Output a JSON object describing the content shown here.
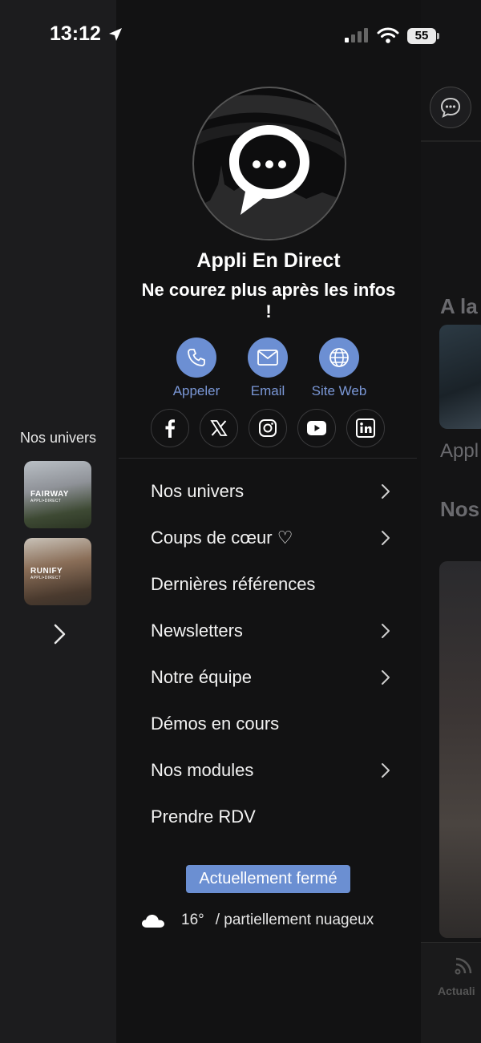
{
  "status_bar": {
    "time": "13:12",
    "battery": "55"
  },
  "left_rail": {
    "title": "Nos univers",
    "items": [
      {
        "brand": "FAIRWAY",
        "sub": "APPLI•DIRECT"
      },
      {
        "brand": "RUNIFY",
        "sub": "APPLI•DIRECT"
      }
    ]
  },
  "profile": {
    "name": "Appli En Direct",
    "tagline": "Ne courez plus après les infos !"
  },
  "actions": {
    "call": "Appeler",
    "email": "Email",
    "web": "Site Web"
  },
  "menu": {
    "items": [
      {
        "label": "Nos univers",
        "has_chevron": true
      },
      {
        "label": "Coups de cœur ♡",
        "has_chevron": true
      },
      {
        "label": "Dernières références",
        "has_chevron": false
      },
      {
        "label": "Newsletters",
        "has_chevron": true
      },
      {
        "label": "Notre équipe",
        "has_chevron": true
      },
      {
        "label": "Démos en cours",
        "has_chevron": false
      },
      {
        "label": "Nos modules",
        "has_chevron": true
      },
      {
        "label": "Prendre RDV",
        "has_chevron": false
      }
    ]
  },
  "status": {
    "label": "Actuellement fermé"
  },
  "weather": {
    "temp": "16°",
    "description": "/ partiellement nuageux"
  },
  "background_app": {
    "heading1": "A la",
    "item_text": "Appl",
    "heading2": "Nos",
    "tab_label": "Actuali"
  },
  "colors": {
    "accent": "#6c8fd3",
    "drawer_bg": "#121213",
    "rail_bg": "#1c1c1e"
  }
}
